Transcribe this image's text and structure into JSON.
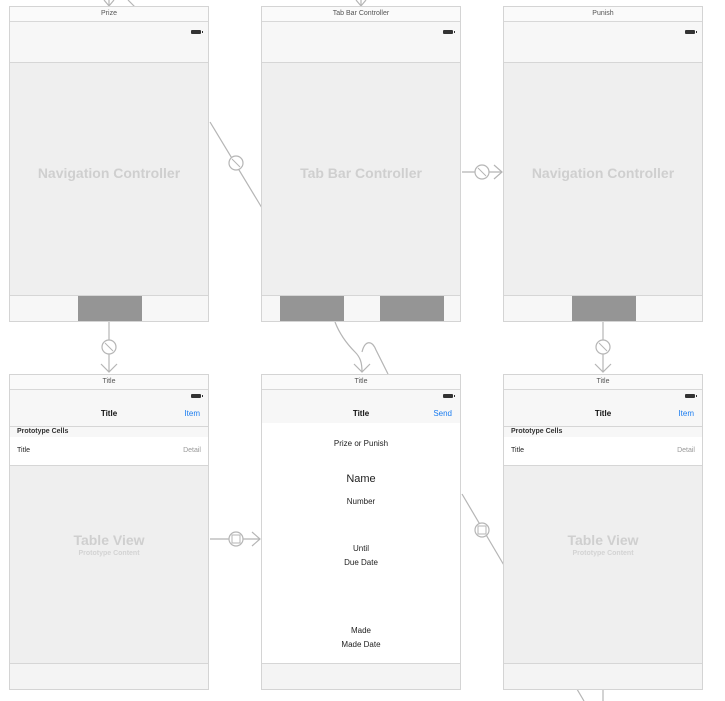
{
  "scenes": {
    "prize_nav": {
      "title": "Prize",
      "label": "Navigation Controller"
    },
    "tab_bar": {
      "title": "Tab Bar Controller",
      "label": "Tab Bar Controller"
    },
    "punish_nav": {
      "title": "Punish",
      "label": "Navigation Controller"
    },
    "left_table": {
      "scene_title": "Title",
      "nav_title": "Title",
      "nav_item": "Item",
      "section_header": "Prototype Cells",
      "cell_title": "Title",
      "cell_detail": "Detail",
      "placeholder_title": "Table View",
      "placeholder_subtitle": "Prototype Content"
    },
    "form": {
      "scene_title": "Title",
      "nav_title": "Title",
      "nav_item": "Send",
      "prize_or_punish": "Prize or Punish",
      "name": "Name",
      "number": "Number",
      "until": "Until",
      "due_date": "Due Date",
      "made": "Made",
      "made_date": "Made Date"
    },
    "right_table": {
      "scene_title": "Title",
      "nav_title": "Title",
      "nav_item": "Item",
      "section_header": "Prototype Cells",
      "cell_title": "Title",
      "cell_detail": "Detail",
      "placeholder_title": "Table View",
      "placeholder_subtitle": "Prototype Content"
    }
  },
  "segues": [
    {
      "name": "relationship-segue-tabbar-to-prize",
      "icon": "relationship-icon"
    },
    {
      "name": "relationship-segue-tabbar-to-punish",
      "icon": "relationship-icon"
    },
    {
      "name": "root-segue-prize",
      "icon": "relationship-icon"
    },
    {
      "name": "root-segue-punish",
      "icon": "relationship-icon"
    },
    {
      "name": "push-segue-table-to-form",
      "icon": "push-segue-icon"
    },
    {
      "name": "push-segue-form-to-right",
      "icon": "push-segue-icon"
    }
  ],
  "colors": {
    "accent": "#1a7cf0",
    "placeholder_text": "#cfcfcf",
    "tab_block": "#959595",
    "connector": "#b5b5b5"
  }
}
